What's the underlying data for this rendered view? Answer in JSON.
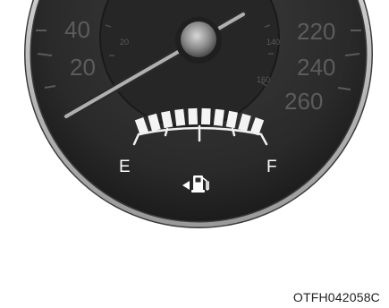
{
  "image_code": "OTFH042058C",
  "speedometer": {
    "outer_left_labels": [
      "40",
      "20"
    ],
    "outer_right_labels": [
      "220",
      "240",
      "260"
    ],
    "inner_labels": [
      "20",
      "140",
      "160"
    ]
  },
  "fuel_gauge": {
    "empty_label": "E",
    "full_label": "F",
    "level_fraction": 1.0,
    "segments_lit": 10,
    "segments_total": 10,
    "icon": "fuel-pump-icon",
    "filler_side_indicator": "left-arrow-icon"
  },
  "colors": {
    "bezel": "#cfcfcf",
    "dial_face": "#2b2b2b",
    "segment_on": "#f4f4f4",
    "label": "#ffffff",
    "needle": "#b0b0b0"
  }
}
